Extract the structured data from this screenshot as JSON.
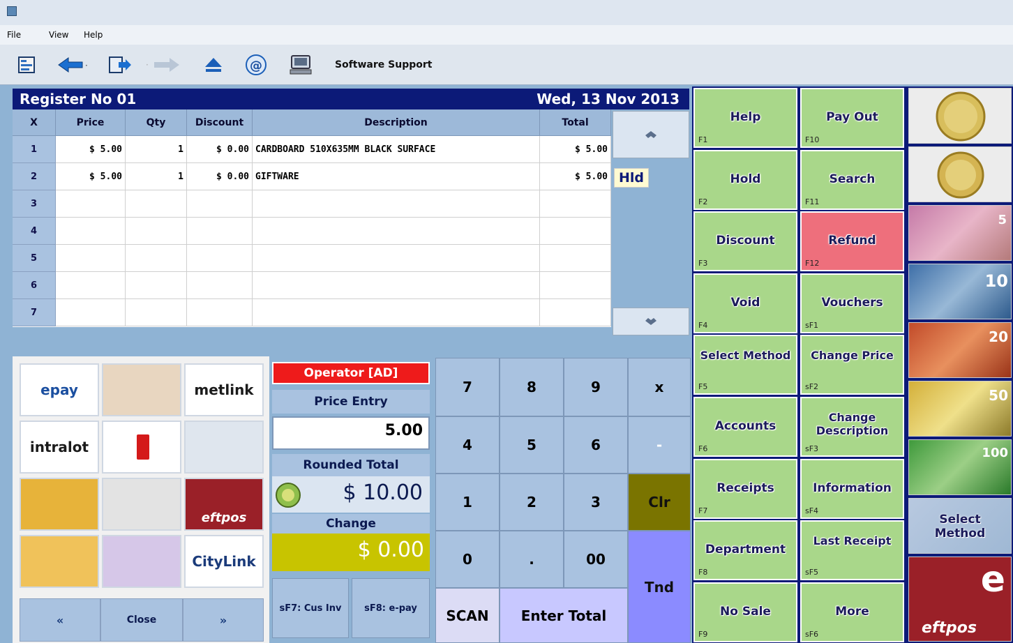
{
  "menu": {
    "file": "File",
    "view": "View",
    "help": "Help"
  },
  "toolbar": {
    "support_label": "Software Support"
  },
  "register": {
    "title": "Register No 01",
    "date": "Wed, 13 Nov 2013"
  },
  "grid": {
    "headers": [
      "X",
      "Price",
      "Qty",
      "Discount",
      "Description",
      "Total"
    ],
    "rows": [
      {
        "n": "1",
        "price": "$ 5.00",
        "qty": "1",
        "discount": "$ 0.00",
        "description": "CARDBOARD 510X635MM BLACK SURFACE",
        "total": "$ 5.00"
      },
      {
        "n": "2",
        "price": "$ 5.00",
        "qty": "1",
        "discount": "$ 0.00",
        "description": "GIFTWARE",
        "total": "$ 5.00"
      },
      {
        "n": "3",
        "price": "",
        "qty": "",
        "discount": "",
        "description": "",
        "total": ""
      },
      {
        "n": "4",
        "price": "",
        "qty": "",
        "discount": "",
        "description": "",
        "total": ""
      },
      {
        "n": "5",
        "price": "",
        "qty": "",
        "discount": "",
        "description": "",
        "total": ""
      },
      {
        "n": "6",
        "price": "",
        "qty": "",
        "discount": "",
        "description": "",
        "total": ""
      },
      {
        "n": "7",
        "price": "",
        "qty": "",
        "discount": "",
        "description": "",
        "total": ""
      }
    ],
    "hold_label": "Hld"
  },
  "shortcuts": {
    "tiles": [
      "epay",
      "",
      "metlink",
      "intralot",
      "",
      "",
      "",
      "",
      "eftpos",
      "",
      "",
      "CityLink"
    ],
    "close": "Close",
    "prev": "«",
    "next": "»"
  },
  "operator": {
    "operator_label": "Operator [AD]",
    "mode_label": "Price Entry",
    "entry_value": "5.00",
    "rounded_label": "Rounded Total",
    "rounded_value": "$ 10.00",
    "change_label": "Change",
    "change_value": "$ 0.00",
    "sf7": "sF7: Cus Inv",
    "sf8": "sF8: e-pay"
  },
  "keypad": {
    "k7": "7",
    "k8": "8",
    "k9": "9",
    "kx": "x",
    "k4": "4",
    "k5": "5",
    "k6": "6",
    "kminus": "-",
    "k1": "1",
    "k2": "2",
    "k3": "3",
    "kclr": "Clr",
    "k0": "0",
    "kdot": ".",
    "k00": "00",
    "ktnd": "Tnd",
    "scan": "SCAN",
    "enter_total": "Enter Total"
  },
  "function_keys": [
    {
      "label": "Help",
      "fn": "F1"
    },
    {
      "label": "Pay Out",
      "fn": "F10"
    },
    {
      "label": "Hold",
      "fn": "F2"
    },
    {
      "label": "Search",
      "fn": "F11"
    },
    {
      "label": "Discount",
      "fn": "F3"
    },
    {
      "label": "Refund",
      "fn": "F12"
    },
    {
      "label": "Void",
      "fn": "F4"
    },
    {
      "label": "Vouchers",
      "fn": "sF1"
    },
    {
      "label": "Select Method",
      "fn": "F5"
    },
    {
      "label": "Change Price",
      "fn": "sF2"
    },
    {
      "label": "Accounts",
      "fn": "F6"
    },
    {
      "label": "Change Description",
      "fn": "sF3"
    },
    {
      "label": "Receipts",
      "fn": "F7"
    },
    {
      "label": "Information",
      "fn": "sF4"
    },
    {
      "label": "Department",
      "fn": "F8"
    },
    {
      "label": "Last Receipt",
      "fn": "sF5"
    },
    {
      "label": "No Sale",
      "fn": "F9"
    },
    {
      "label": "More",
      "fn": "sF6"
    }
  ],
  "money": {
    "notes": [
      "5",
      "10",
      "20",
      "50",
      "100"
    ],
    "select_method": "Select Method",
    "eftpos": "eftpos"
  },
  "colors": {
    "header_navy": "#0c1a78",
    "panel_blue": "#8fb3d4",
    "key_green": "#a9d78a",
    "refund_red": "#ee6f7c",
    "operator_red": "#ee1b1b",
    "change_yellow": "#c8c400",
    "tnd_purple": "#8b8bff",
    "clr_olive": "#7a7400"
  }
}
